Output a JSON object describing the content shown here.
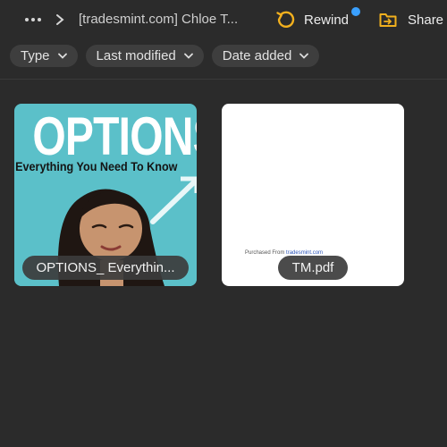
{
  "toolbar": {
    "more_icon": "more-dots-icon",
    "breadcrumb": "[tradesmint.com] Chloe T...",
    "rewind_label": "Rewind",
    "rewind_icon": "rewind-icon",
    "rewind_color": "#f2b01e",
    "notification_color": "#3aa0ff",
    "share_label": "Share f",
    "share_icon": "share-folder-icon"
  },
  "filters": [
    {
      "label": "Type"
    },
    {
      "label": "Last modified"
    },
    {
      "label": "Date added"
    }
  ],
  "files": [
    {
      "name": "OPTIONS_ Everythin...",
      "thumb": {
        "title": "OPTIONS",
        "subtitle": "Everything You Need To Know"
      },
      "thumb_bg": "#5bc0c9"
    },
    {
      "name": "TM.pdf",
      "thumb": {
        "line_prefix": "Purchased From ",
        "line_link": "tradesmint.com"
      },
      "thumb_bg": "#ffffff"
    }
  ],
  "colors": {
    "background": "#2b2b2b",
    "chip": "#3e3e3e",
    "text": "#e6e6e6"
  }
}
